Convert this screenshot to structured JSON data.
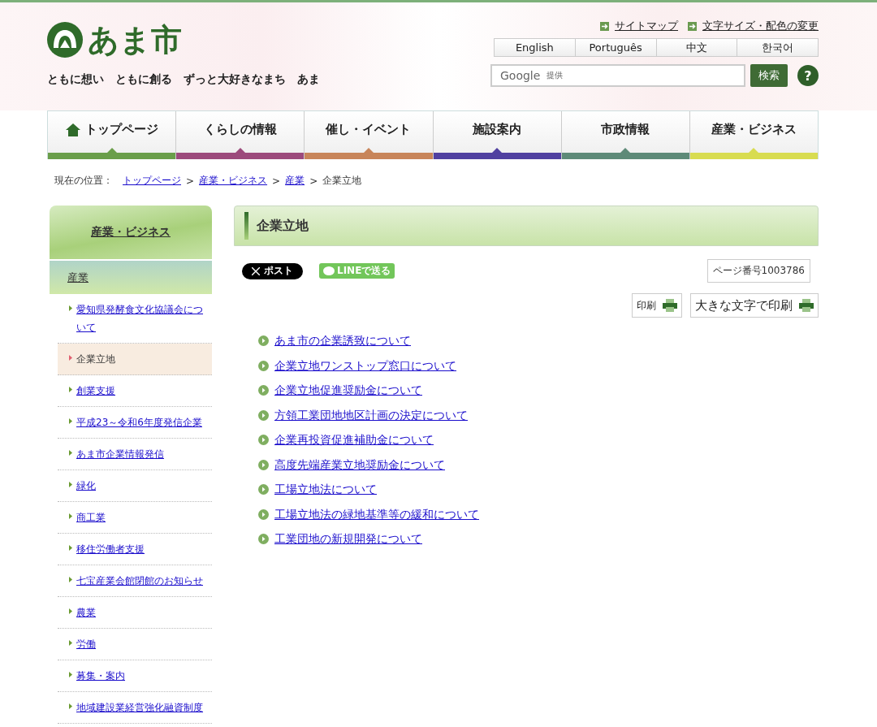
{
  "header": {
    "logo_text": "あま市",
    "tagline": "ともに想い　ともに創る　ずっと大好きなまち　あま",
    "util_links": [
      "サイトマップ",
      "文字サイズ・配色の変更"
    ],
    "languages": [
      "English",
      "Português",
      "中文",
      "한국어"
    ],
    "search": {
      "placeholder": "提供",
      "brand": "Google",
      "button": "検索",
      "help": "?"
    }
  },
  "nav": [
    {
      "label": "トップページ",
      "color": "#6a9e4a"
    },
    {
      "label": "くらしの情報",
      "color": "#9c4a7c"
    },
    {
      "label": "催し・イベント",
      "color": "#c8855a"
    },
    {
      "label": "施設案内",
      "color": "#5040a0"
    },
    {
      "label": "市政情報",
      "color": "#5e8a78"
    },
    {
      "label": "産業・ビジネス",
      "color": "#d8dc50"
    }
  ],
  "breadcrumb": {
    "label": "現在の位置：",
    "links": [
      "トップページ",
      "産業・ビジネス",
      "産業"
    ],
    "separator": ">",
    "current": "企業立地"
  },
  "sidebar": {
    "title": "産業・ビジネス",
    "section": "産業",
    "items": [
      {
        "label": "愛知県発酵食文化協議会について",
        "selected": false
      },
      {
        "label": "企業立地",
        "selected": true
      },
      {
        "label": "創業支援",
        "selected": false
      },
      {
        "label": "平成23～令和6年度発信企業",
        "selected": false
      },
      {
        "label": "あま市企業情報発信",
        "selected": false
      },
      {
        "label": "緑化",
        "selected": false
      },
      {
        "label": "商工業",
        "selected": false
      },
      {
        "label": "移住労働者支援",
        "selected": false
      },
      {
        "label": "七宝産業会館閉館のお知らせ",
        "selected": false
      },
      {
        "label": "農業",
        "selected": false
      },
      {
        "label": "労働",
        "selected": false
      },
      {
        "label": "募集・案内",
        "selected": false
      },
      {
        "label": "地域建設業経営強化融資制度",
        "selected": false
      }
    ]
  },
  "main": {
    "title": "企業立地",
    "share": {
      "x_post": "ポスト",
      "line": "LINEで送る"
    },
    "page_number": "ページ番号1003786",
    "print": "印刷",
    "print_large": "大きな文字で印刷",
    "links": [
      "あま市の企業誘致について",
      "企業立地ワンストップ窓口について",
      "企業立地促進奨励金について",
      "方領工業団地地区計画の決定について",
      "企業再投資促進補助金について",
      "高度先端産業立地奨励金について",
      "工場立地法について",
      "工場立地法の緑地基準等の緩和について",
      "工業団地の新規開発について"
    ]
  }
}
